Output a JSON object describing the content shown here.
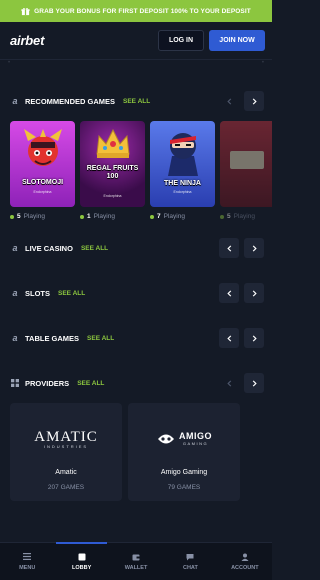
{
  "promo": {
    "text": "GRAB YOUR BONUS FOR FIRST DEPOSIT  100% TO YOUR DEPOSIT"
  },
  "header": {
    "logo": "airbet",
    "login_label": "LOG IN",
    "join_label": "JOIN NOW"
  },
  "sections": {
    "recommended": {
      "title": "RECOMMENDED GAMES",
      "link": "SEE ALL"
    },
    "live_casino": {
      "title": "LIVE CASINO",
      "link": "SEE ALL"
    },
    "slots": {
      "title": "SLOTS",
      "link": "SEE ALL"
    },
    "table_games": {
      "title": "TABLE GAMES",
      "link": "SEE ALL"
    },
    "providers": {
      "title": "PROVIDERS",
      "link": "SEE ALL"
    }
  },
  "games": [
    {
      "name": "SLOTOMOJI",
      "provider": "Endorphina",
      "playing_count": "5",
      "playing_label": "Playing",
      "color_top": "#c63cd9",
      "color_bottom": "#7a1aa6"
    },
    {
      "name": "REGAL FRUITS 100",
      "provider": "Endorphina",
      "playing_count": "1",
      "playing_label": "Playing",
      "color_top": "#7a1a8c",
      "color_bottom": "#2a0a3a"
    },
    {
      "name": "THE NINJA",
      "provider": "Endorphina",
      "playing_count": "7",
      "playing_label": "Playing",
      "color_top": "#4d6de0",
      "color_bottom": "#2438a8"
    },
    {
      "name": "",
      "provider": "",
      "playing_count": "5",
      "playing_label": "Playing",
      "color_top": "#c82c3c",
      "color_bottom": "#6e1520"
    }
  ],
  "providers": [
    {
      "name": "Amatic",
      "logo_text": "AMATIC",
      "logo_sub": "INDUSTRIES",
      "count": "207 GAMES"
    },
    {
      "name": "Amigo Gaming",
      "logo_text": "AMIGO",
      "logo_sub": "GAMING",
      "count": "79 GAMES"
    }
  ],
  "nav": [
    {
      "label": "MENU",
      "icon": "menu-icon",
      "active": false
    },
    {
      "label": "LOBBY",
      "icon": "lobby-icon",
      "active": true
    },
    {
      "label": "WALLET",
      "icon": "wallet-icon",
      "active": false
    },
    {
      "label": "CHAT",
      "icon": "chat-icon",
      "active": false
    },
    {
      "label": "ACCOUNT",
      "icon": "account-icon",
      "active": false
    }
  ],
  "colors": {
    "accent_green": "#8cc63f",
    "brand_blue": "#2f5bd3",
    "background": "#141a26"
  }
}
